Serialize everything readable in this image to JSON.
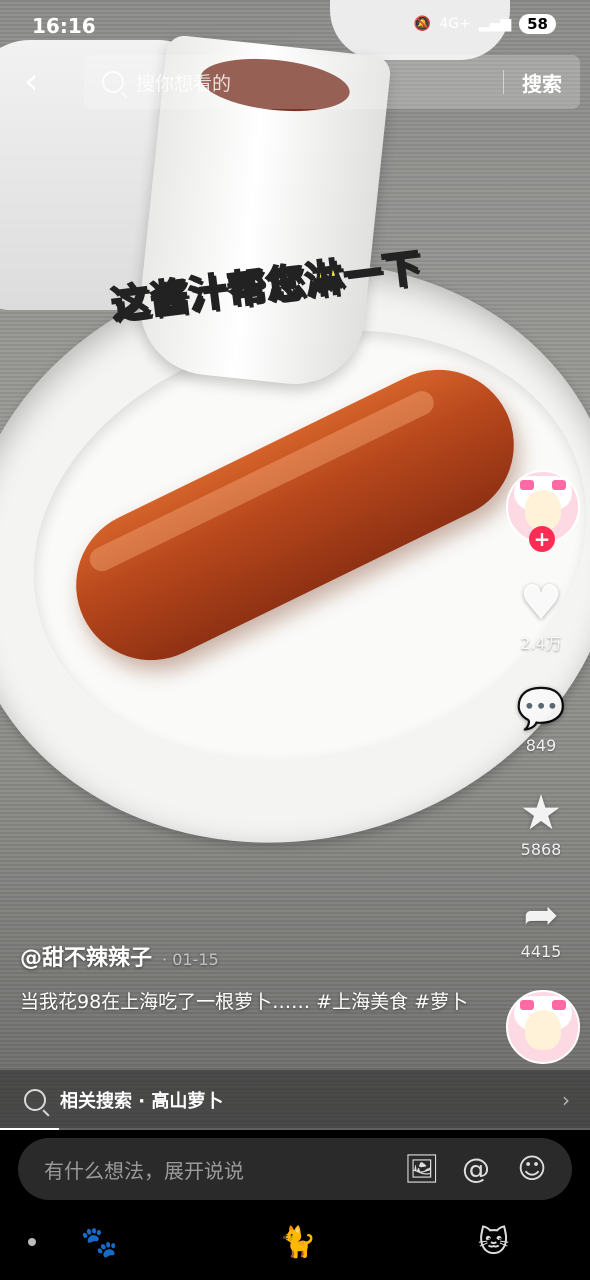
{
  "status": {
    "time": "16:16",
    "network": "4G+",
    "battery": "58"
  },
  "search": {
    "placeholder": "搜你想看的",
    "button": "搜索"
  },
  "video": {
    "sticker_text": "这酱汁帮您淋一下"
  },
  "sidebar": {
    "likes": "2.4万",
    "comments": "849",
    "favorites": "5868",
    "shares": "4415"
  },
  "post": {
    "author": "@甜不辣辣子",
    "date": "· 01-15",
    "description": "当我花98在上海吃了一根萝卜…… #上海美食 #萝卜"
  },
  "related_search": {
    "label": "相关搜索 · 高山萝卜"
  },
  "progress": {
    "fraction": 0.1
  },
  "comment": {
    "placeholder": "有什么想法，展开说说"
  },
  "colors": {
    "accent": "#fe2c55",
    "sticker": "#ffe84a"
  }
}
